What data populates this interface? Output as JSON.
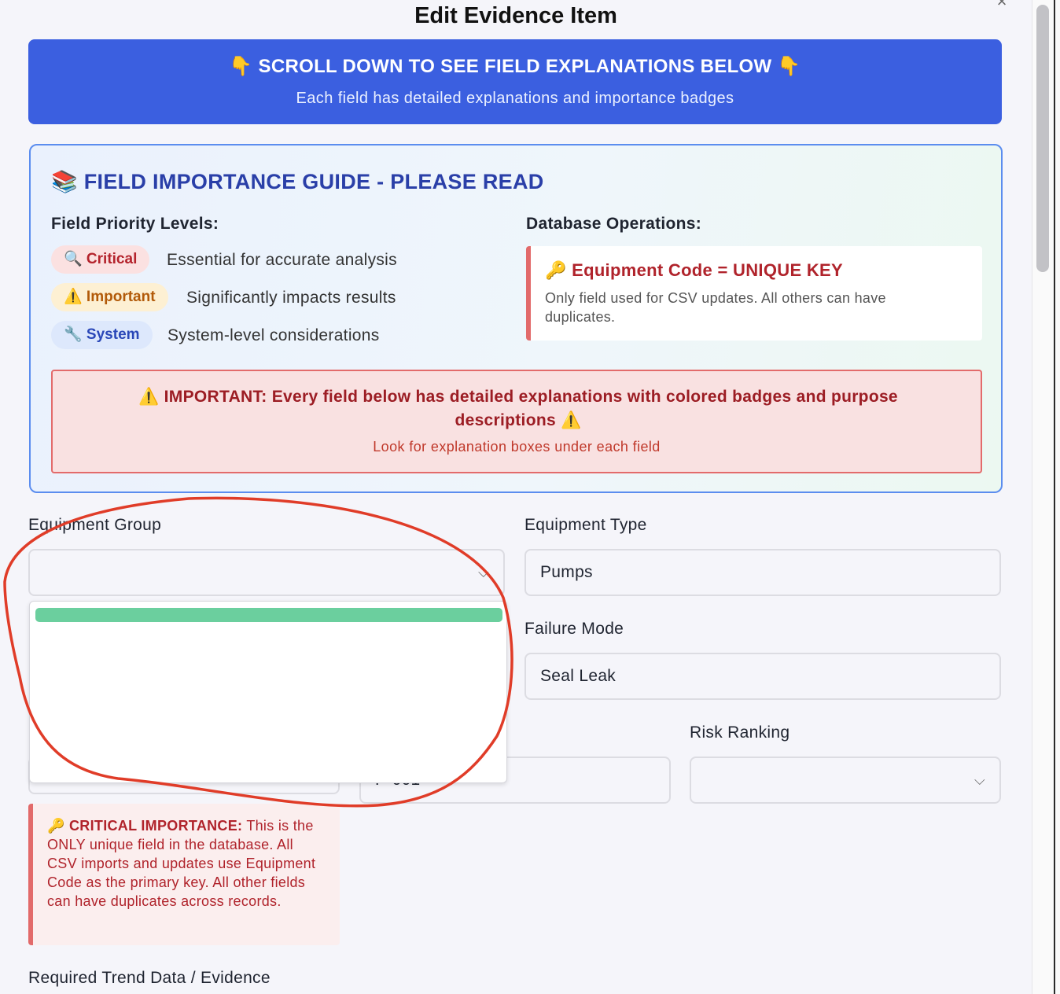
{
  "dialog": {
    "title": "Edit Evidence Item",
    "close_label": "×"
  },
  "banner": {
    "title": "👇 SCROLL DOWN TO SEE FIELD EXPLANATIONS BELOW 👇",
    "subtitle": "Each field has detailed explanations and importance badges"
  },
  "guide": {
    "title": "📚 FIELD IMPORTANCE GUIDE - PLEASE READ",
    "priority_heading": "Field Priority Levels:",
    "levels": [
      {
        "badge": "🔍 Critical",
        "desc": "Essential for accurate analysis"
      },
      {
        "badge": "⚠️ Important",
        "desc": "Significantly impacts results"
      },
      {
        "badge": "🔧 System",
        "desc": "System-level considerations"
      }
    ],
    "db_heading": "Database Operations:",
    "db_key": "🔑 Equipment Code = UNIQUE KEY",
    "db_desc": "Only field used for CSV updates. All others can have duplicates.",
    "warning": "⚠️ IMPORTANT: Every field below has detailed explanations with colored badges and purpose descriptions ⚠️",
    "warning_sub": "Look for explanation boxes under each field"
  },
  "form": {
    "equipment_group": {
      "label": "Equipment Group",
      "value": ""
    },
    "equipment_type": {
      "label": "Equipment Type",
      "value": "Pumps"
    },
    "failure_mode": {
      "label": "Failure Mode",
      "value": "Seal Leak"
    },
    "risk_ranking": {
      "label": "Risk Ranking",
      "value": ""
    },
    "equipment_code_partial": "P-001",
    "critical_note_heading": "🔑 CRITICAL IMPORTANCE:",
    "critical_note_body": " This is the ONLY unique field in the database. All CSV imports and updates use Equipment Code as the primary key. All other fields can have duplicates across records.",
    "trend_label": "Required Trend Data / Evidence"
  },
  "colors": {
    "banner": "#3b5fe0",
    "guide_border": "#5b8def",
    "critical": "#b4232c",
    "important": "#b25a09",
    "system": "#2a47b8",
    "dropdown_highlight": "#6bcf9e",
    "annotation": "#e03c28"
  }
}
